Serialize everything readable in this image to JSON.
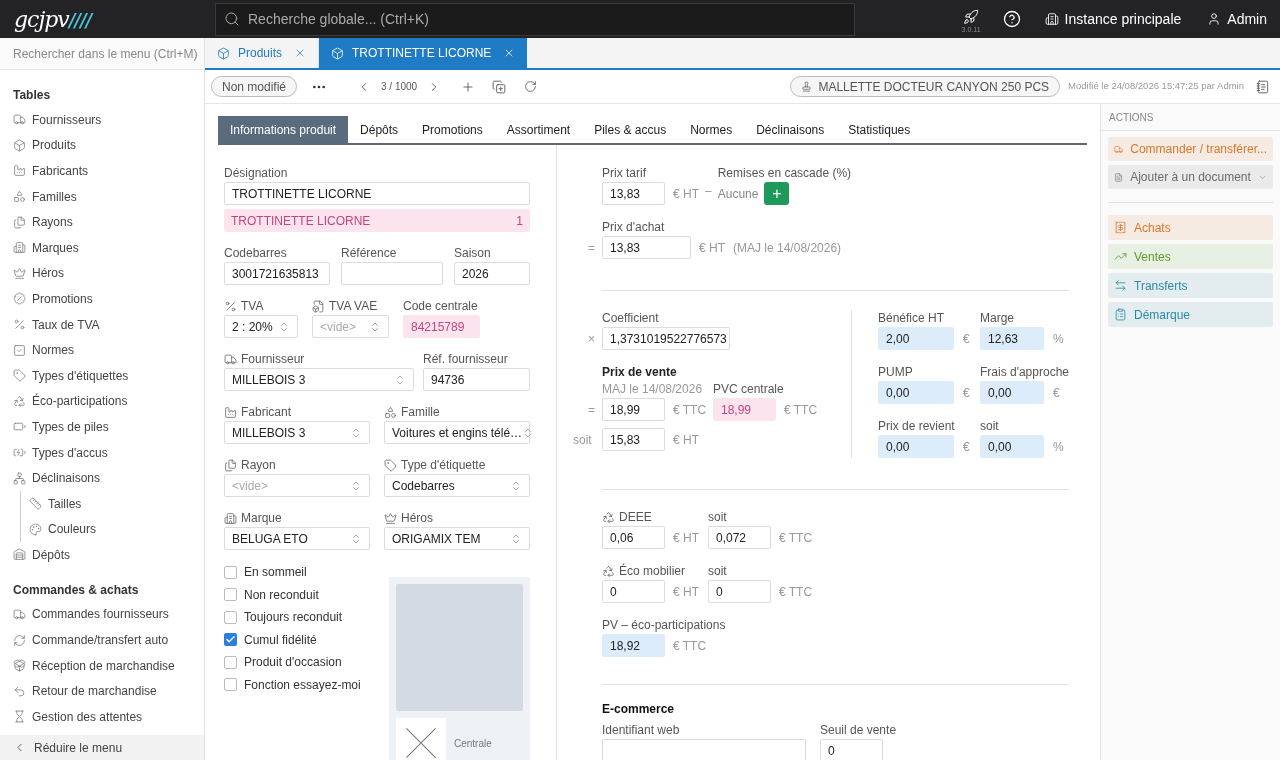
{
  "topbar": {
    "logo": "gcjpv",
    "logo_mark": "////",
    "search_placeholder": "Recherche globale... (Ctrl+K)",
    "version": "3.0.11",
    "instance": "Instance principale",
    "user": "Admin"
  },
  "sidebar": {
    "search_placeholder": "Rechercher dans le menu (Ctrl+M)",
    "sections": [
      {
        "title": "Tables",
        "items": [
          {
            "label": "Fournisseurs"
          },
          {
            "label": "Produits"
          },
          {
            "label": "Fabricants"
          },
          {
            "label": "Familles"
          },
          {
            "label": "Rayons"
          },
          {
            "label": "Marques"
          },
          {
            "label": "Héros"
          },
          {
            "label": "Promotions"
          },
          {
            "label": "Taux de TVA"
          },
          {
            "label": "Normes"
          },
          {
            "label": "Types d'étiquettes"
          },
          {
            "label": "Éco-participations"
          },
          {
            "label": "Types de piles"
          },
          {
            "label": "Types d'accus"
          },
          {
            "label": "Déclinaisons",
            "children": [
              {
                "label": "Tailles"
              },
              {
                "label": "Couleurs"
              }
            ]
          },
          {
            "label": "Dépôts"
          }
        ]
      },
      {
        "title": "Commandes & achats",
        "items": [
          {
            "label": "Commandes fournisseurs"
          },
          {
            "label": "Commande/transfert auto"
          },
          {
            "label": "Réception de marchandise"
          },
          {
            "label": "Retour de marchandise"
          },
          {
            "label": "Gestion des attentes"
          }
        ]
      }
    ],
    "collapse": "Réduire le menu"
  },
  "tabs": [
    {
      "label": "Produits",
      "selected": false
    },
    {
      "label": "TROTTINETTE LICORNE",
      "selected": true
    }
  ],
  "toolbar": {
    "status": "Non modifié",
    "pager": "3 / 1000",
    "linked_product": "MALLETTE DOCTEUR CANYON 250 PCS",
    "modified": "Modifié le 24/08/2026 15:47:25 par Admin"
  },
  "subtabs": [
    {
      "label": "Informations produit",
      "selected": true
    },
    {
      "label": "Dépôts",
      "selected": false
    },
    {
      "label": "Promotions",
      "selected": false
    },
    {
      "label": "Assortiment",
      "selected": false
    },
    {
      "label": "Piles & accus",
      "selected": false
    },
    {
      "label": "Normes",
      "selected": false
    },
    {
      "label": "Déclinaisons",
      "selected": false
    },
    {
      "label": "Statistiques",
      "selected": false
    }
  ],
  "product": {
    "designation": {
      "label": "Désignation",
      "value": "TROTTINETTE LICORNE"
    },
    "central_designation": {
      "value": "TROTTINETTE LICORNE",
      "count": "1"
    },
    "rows": [
      [
        {
          "label": "Codebarres",
          "kind": "input",
          "value": "3001721635813"
        },
        {
          "label": "Référence",
          "kind": "input"
        },
        {
          "label": "Saison",
          "kind": "input",
          "value": "2026"
        }
      ],
      [
        {
          "label": "TVA",
          "kind": "select",
          "value": "2 : 20%"
        },
        {
          "label": "TVA VAE",
          "kind": "select",
          "placeholder": "<vide>"
        },
        {
          "label": "Code centrale",
          "kind": "central",
          "value": "84215789"
        }
      ],
      [
        {
          "label": "Fournisseur",
          "kind": "select",
          "value": "MILLEBOIS 3"
        },
        {
          "label": "Réf. fournisseur",
          "kind": "input",
          "value": "94736"
        }
      ],
      [
        {
          "label": "Fabricant",
          "kind": "select",
          "value": "MILLEBOIS 3"
        },
        {
          "label": "Famille",
          "kind": "select",
          "value": "Voitures et engins télé…"
        }
      ],
      [
        {
          "label": "Rayon",
          "kind": "select",
          "placeholder": "<vide>"
        },
        {
          "label": "Type d'étiquette",
          "kind": "select",
          "value": "Codebarres"
        }
      ],
      [
        {
          "label": "Marque",
          "kind": "select",
          "value": "BELUGA ETO"
        },
        {
          "label": "Héros",
          "kind": "select",
          "value": "ORIGAMIX TEM"
        }
      ]
    ],
    "flags": [
      {
        "label": "En sommeil",
        "checked": false
      },
      {
        "label": "Non reconduit",
        "checked": false
      },
      {
        "label": "Toujours reconduit",
        "checked": false
      },
      {
        "label": "Cumul fidélité",
        "checked": true
      },
      {
        "label": "Produit d'occasion",
        "checked": false
      },
      {
        "label": "Fonction essayez-moi",
        "checked": false
      }
    ],
    "image_caption": "Centrale"
  },
  "pricing": {
    "list_price": {
      "label": "Prix tarif",
      "value": "13,83",
      "unit": "€ HT"
    },
    "dash": "–",
    "discounts": {
      "label": "Remises en cascade (%)",
      "value": "Aucune",
      "add": "+"
    },
    "purchase": {
      "prefix": "=",
      "label": "Prix d'achat",
      "value": "13,83",
      "unit": "€ HT",
      "note": "(MAJ le 14/08/2026)"
    },
    "coefficient": {
      "prefix": "×",
      "label": "Coefficient",
      "value": "1,3731019522776573"
    },
    "sale": {
      "label": "Prix de vente",
      "note": "MAJ le 14/08/2026",
      "prefix": "=",
      "value": "18,99",
      "unit": "€ TTC",
      "central_label": "PVC centrale",
      "central_value": "18,99",
      "central_unit": "€ TTC",
      "net_prefix": "soit",
      "net_value": "15,83",
      "net_unit": "€ HT"
    },
    "stats": [
      {
        "label": "Bénéfice HT",
        "value": "2,00",
        "unit": "€"
      },
      {
        "label": "Marge",
        "value": "12,63",
        "unit": "%"
      },
      {
        "label": "PUMP",
        "value": "0,00",
        "unit": "€"
      },
      {
        "label": "Frais d'approche",
        "value": "0,00",
        "unit": "€"
      },
      {
        "label": "Prix de revient",
        "value": "0,00",
        "unit": "€"
      },
      {
        "label": "soit",
        "value": "0,00",
        "unit": "%"
      }
    ]
  },
  "eco": {
    "rows": [
      {
        "label": "DEEE",
        "value": "0,06",
        "unit": "€ HT",
        "ttc_label": "soit",
        "ttc_value": "0,072",
        "ttc_unit": "€ TTC"
      },
      {
        "label": "Éco mobilier",
        "value": "0",
        "unit": "€ HT",
        "ttc_label": "soit",
        "ttc_value": "0",
        "ttc_unit": "€ TTC"
      }
    ],
    "net": {
      "label": "PV – éco-participations",
      "value": "18,92",
      "unit": "€ TTC"
    }
  },
  "ecommerce": {
    "title": "E-commerce",
    "web_id": {
      "label": "Identifiant web"
    },
    "threshold": {
      "label": "Seuil de vente",
      "value": "0"
    }
  },
  "actions": {
    "title": "ACTIONS",
    "primary": [
      {
        "label": "Commander / transférer...",
        "color": "#d9772b",
        "kind": "button"
      },
      {
        "label": "Ajouter à un document",
        "color": "#6b6b6b",
        "kind": "dropdown"
      }
    ],
    "links": [
      {
        "label": "Achats",
        "color": "#d9772b"
      },
      {
        "label": "Ventes",
        "color": "#5e9a2c"
      },
      {
        "label": "Transferts",
        "color": "#2a8aa3"
      },
      {
        "label": "Démarque",
        "color": "#2a8aa3"
      }
    ]
  }
}
